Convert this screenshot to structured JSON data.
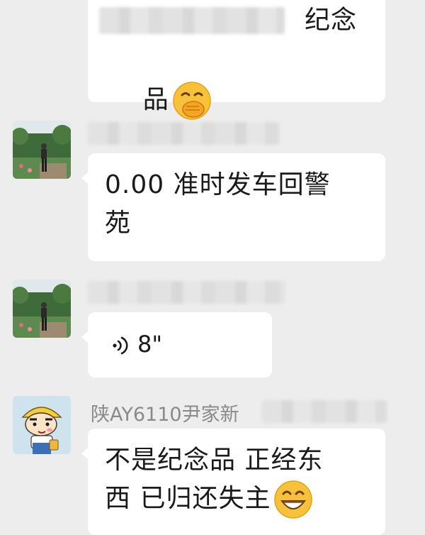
{
  "messages": [
    {
      "id": "m1",
      "text_line1": "纪念",
      "text_line2": "品",
      "emoji": "hand-over-mouth-emoji"
    },
    {
      "id": "m2",
      "avatar": "garden-photo-avatar",
      "text": "0.00 准时发车回警\n苑"
    },
    {
      "id": "m3",
      "avatar": "garden-photo-avatar",
      "voice_duration": "8\"",
      "icon": "voice-wave-icon"
    },
    {
      "id": "m4",
      "avatar": "cartoon-boy-avatar",
      "sender": "陕AY6110尹家新",
      "text": "不是纪念品 正经东\n西 已归还失主",
      "emoji": "grinning-emoji"
    }
  ],
  "colors": {
    "background": "#ededed",
    "bubble": "#ffffff",
    "text": "#1a1a1a",
    "name": "#8a8a8a"
  }
}
